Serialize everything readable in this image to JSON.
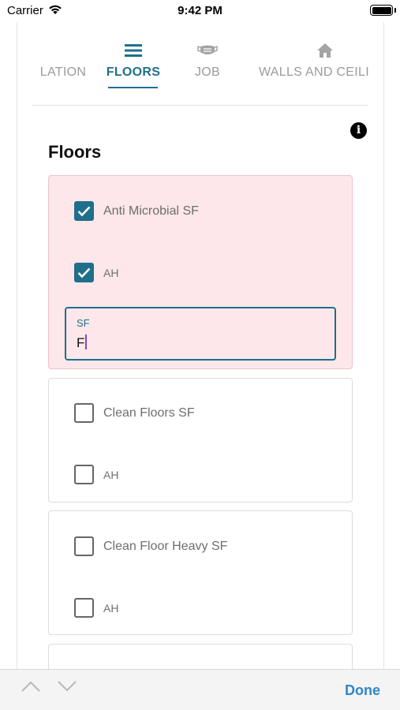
{
  "status_bar": {
    "carrier": "Carrier",
    "time": "9:42 PM"
  },
  "tabs": [
    {
      "label": "LATION",
      "icon": "none",
      "active": false
    },
    {
      "label": "FLOORS",
      "icon": "menu-lines-icon",
      "active": true
    },
    {
      "label": "JOB",
      "icon": "mask-icon",
      "active": false
    },
    {
      "label": "WALLS AND CEILI",
      "icon": "home-icon",
      "active": false
    }
  ],
  "section": {
    "title": "Floors",
    "info_icon": "info-icon"
  },
  "cards": [
    {
      "primary": {
        "label": "Anti Microbial SF",
        "checked": true
      },
      "secondary": {
        "label": "AH",
        "checked": true
      },
      "field": {
        "label": "SF",
        "value": "F"
      }
    },
    {
      "primary": {
        "label": "Clean Floors SF",
        "checked": false
      },
      "secondary": {
        "label": "AH",
        "checked": false
      }
    },
    {
      "primary": {
        "label": "Clean Floor Heavy SF",
        "checked": false
      },
      "secondary": {
        "label": "AH",
        "checked": false
      }
    }
  ],
  "accessory_bar": {
    "done_label": "Done"
  },
  "colors": {
    "accent": "#1f6f8b",
    "selected_card_bg": "#fde7ea",
    "done": "#2e86c8"
  }
}
